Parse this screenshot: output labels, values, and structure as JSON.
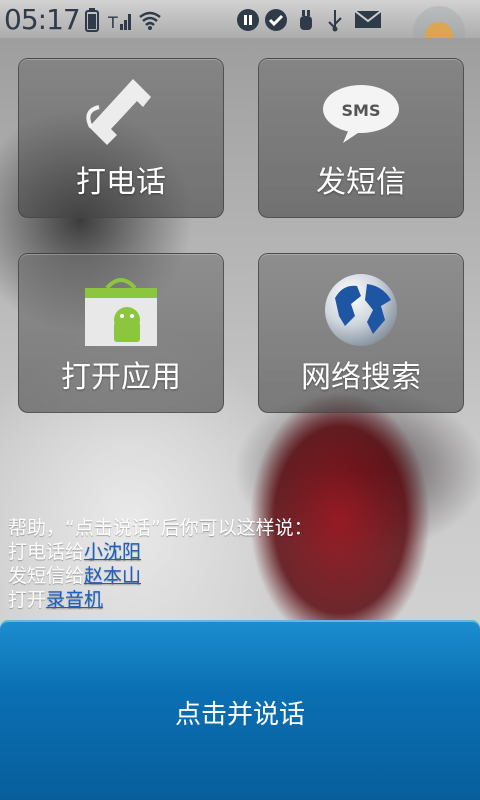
{
  "status_bar": {
    "time": "05:17",
    "icons": [
      "battery-icon",
      "signal-icon",
      "wifi-icon",
      "pause-icon",
      "check-icon",
      "usb-debug-icon",
      "usb-icon",
      "mail-icon"
    ]
  },
  "tiles": [
    {
      "label": "打电话",
      "icon": "phone-icon"
    },
    {
      "label": "发短信",
      "icon": "sms-icon",
      "icon_text": "SMS"
    },
    {
      "label": "打开应用",
      "icon": "market-bag-icon"
    },
    {
      "label": "网络搜索",
      "icon": "globe-icon"
    }
  ],
  "help": {
    "intro": "帮助，“点击说话”后你可以这样说：",
    "lines": [
      {
        "prefix": "打电话给",
        "link": "小沈阳"
      },
      {
        "prefix": "发短信给",
        "link": "赵本山"
      },
      {
        "prefix": "打开",
        "link": "录音机"
      }
    ]
  },
  "main_button": {
    "label": "点击并说话"
  },
  "colors": {
    "button_blue": "#0a6fb3",
    "link_blue": "#1f5fc0"
  }
}
